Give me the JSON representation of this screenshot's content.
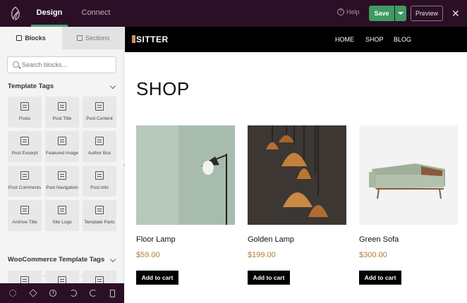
{
  "topbar": {
    "tabs": [
      "Design",
      "Connect"
    ],
    "help_label": "Help",
    "save_label": "Save",
    "preview_label": "Preview",
    "close_glyph": "✕"
  },
  "sidebar": {
    "tabs": [
      "Blocks",
      "Sections"
    ],
    "search_placeholder": "Search blocks...",
    "sections": [
      {
        "title": "Template Tags",
        "blocks": [
          "Posts",
          "Post Title",
          "Post Content",
          "Post Excerpt",
          "Featured Image",
          "Author Box",
          "Post Comments",
          "Post Navigation",
          "Post Info",
          "Archive Title",
          "Site Logo",
          "Template Parts"
        ]
      },
      {
        "title": "WooCommerce Template Tags"
      }
    ],
    "bottom_icons": [
      "gear-icon",
      "layers-icon",
      "history-icon",
      "undo-icon",
      "redo-icon",
      "mobile-icon"
    ]
  },
  "site": {
    "brand": "SITTER",
    "nav": [
      "HOME",
      "SHOP",
      "BLOG"
    ],
    "page_title": "SHOP",
    "products": [
      {
        "name": "Floor Lamp",
        "price": "$59.00",
        "button": "Add to cart"
      },
      {
        "name": "Golden Lamp",
        "price": "$199.00",
        "button": "Add to cart"
      },
      {
        "name": "Green Sofa",
        "price": "$300.00",
        "button": "Add to cart"
      }
    ]
  },
  "colors": {
    "topbar_bg": "#2b0f27",
    "accent_green": "#3f9a62",
    "price_gold": "#b07d3a"
  }
}
